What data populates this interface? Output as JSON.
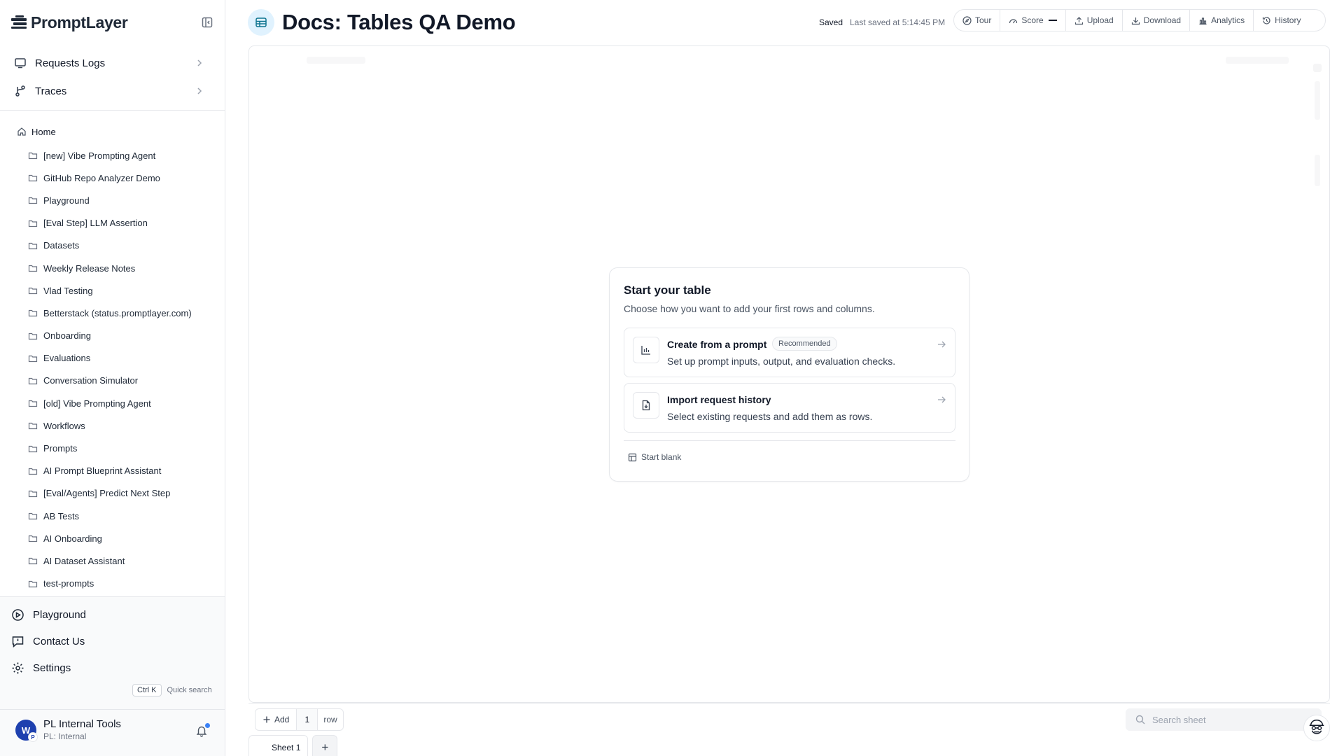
{
  "app": {
    "brand": "PromptLayer"
  },
  "sidebar": {
    "nav": [
      {
        "label": "Requests Logs",
        "icon": "monitor-icon"
      },
      {
        "label": "Traces",
        "icon": "branch-icon"
      }
    ],
    "home_label": "Home",
    "folders": [
      "[new] Vibe Prompting Agent",
      "GitHub Repo Analyzer Demo",
      "Playground",
      "[Eval Step] LLM Assertion",
      "Datasets",
      "Weekly Release Notes",
      "Vlad Testing",
      "Betterstack (status.promptlayer.com)",
      "Onboarding",
      "Evaluations",
      "Conversation Simulator",
      "[old] Vibe Prompting Agent",
      "Workflows",
      "Prompts",
      "AI Prompt Blueprint Assistant",
      "[Eval/Agents] Predict Next Step",
      "AB Tests",
      "AI Onboarding",
      "AI Dataset Assistant",
      "test-prompts"
    ],
    "bottom_nav": {
      "playground": "Playground",
      "contact": "Contact Us",
      "settings": "Settings"
    },
    "quick_search": {
      "kbd": "Ctrl K",
      "label": "Quick search"
    },
    "workspace": {
      "name": "PL Internal Tools",
      "sub": "PL: Internal",
      "avatar_letter": "W",
      "avatar_badge": "P"
    }
  },
  "header": {
    "title": "Docs: Tables QA Demo",
    "save_status": "Saved",
    "last_saved": "Last saved at 5:14:45 PM",
    "toolbar": {
      "tour": "Tour",
      "score": "Score",
      "upload": "Upload",
      "download": "Download",
      "analytics": "Analytics",
      "history": "History"
    }
  },
  "card": {
    "title": "Start your table",
    "subtitle": "Choose how you want to add your first rows and columns.",
    "options": [
      {
        "title": "Create from a prompt",
        "badge": "Recommended",
        "desc": "Set up prompt inputs, output, and evaluation checks."
      },
      {
        "title": "Import request history",
        "desc": "Select existing requests and add them as rows."
      }
    ],
    "start_blank": "Start blank"
  },
  "bottom_bar": {
    "add_label": "Add",
    "row_count": "1",
    "row_label": "row",
    "search_placeholder": "Search sheet"
  },
  "tabs": {
    "sheet_name": "Sheet 1",
    "add_symbol": "+"
  },
  "colors": {
    "accent": "#3b82f6",
    "brand_dark": "#1f2937",
    "doc_icon_bg": "#e0f2fe"
  }
}
